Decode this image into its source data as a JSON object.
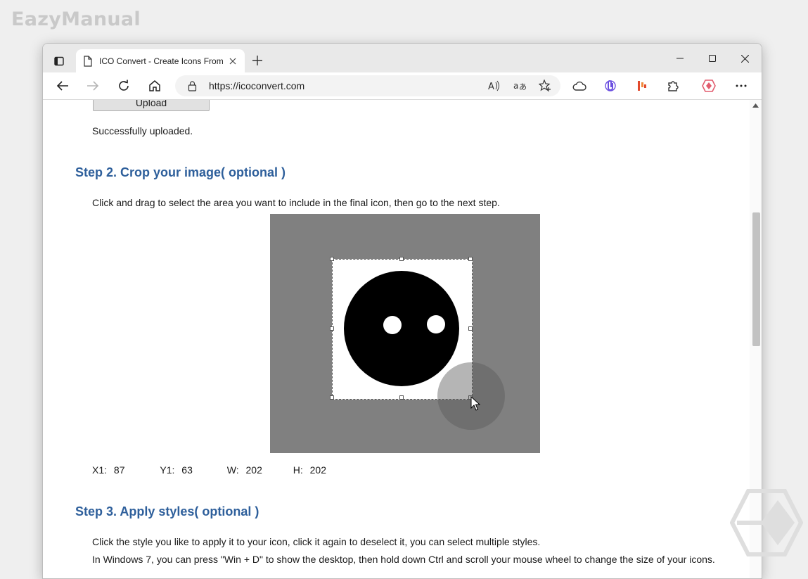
{
  "watermark": {
    "site": "EazyManual"
  },
  "browser": {
    "tab_title": "ICO Convert - Create Icons From",
    "url": "https://icoconvert.com"
  },
  "page": {
    "upload_button": "Upload",
    "upload_status": "Successfully uploaded.",
    "step2": {
      "heading": "Step 2. Crop your image( optional )",
      "instruction": "Click and drag to select the area you want to include in the final icon, then go to the next step."
    },
    "crop": {
      "x1_label": "X1:",
      "x1_value": "87",
      "y1_label": "Y1:",
      "y1_value": "63",
      "w_label": "W:",
      "w_value": "202",
      "h_label": "H:",
      "h_value": "202"
    },
    "step3": {
      "heading": "Step 3. Apply styles( optional )",
      "line1": "Click the style you like to apply it to your icon, click it again to deselect it, you can select multiple styles.",
      "line2": "In Windows 7, you can press \"Win + D\" to show the desktop, then hold down Ctrl and scroll your mouse wheel to change the size of your icons."
    }
  },
  "colors": {
    "heading": "#2e5f9b",
    "crop_background": "#808080"
  }
}
